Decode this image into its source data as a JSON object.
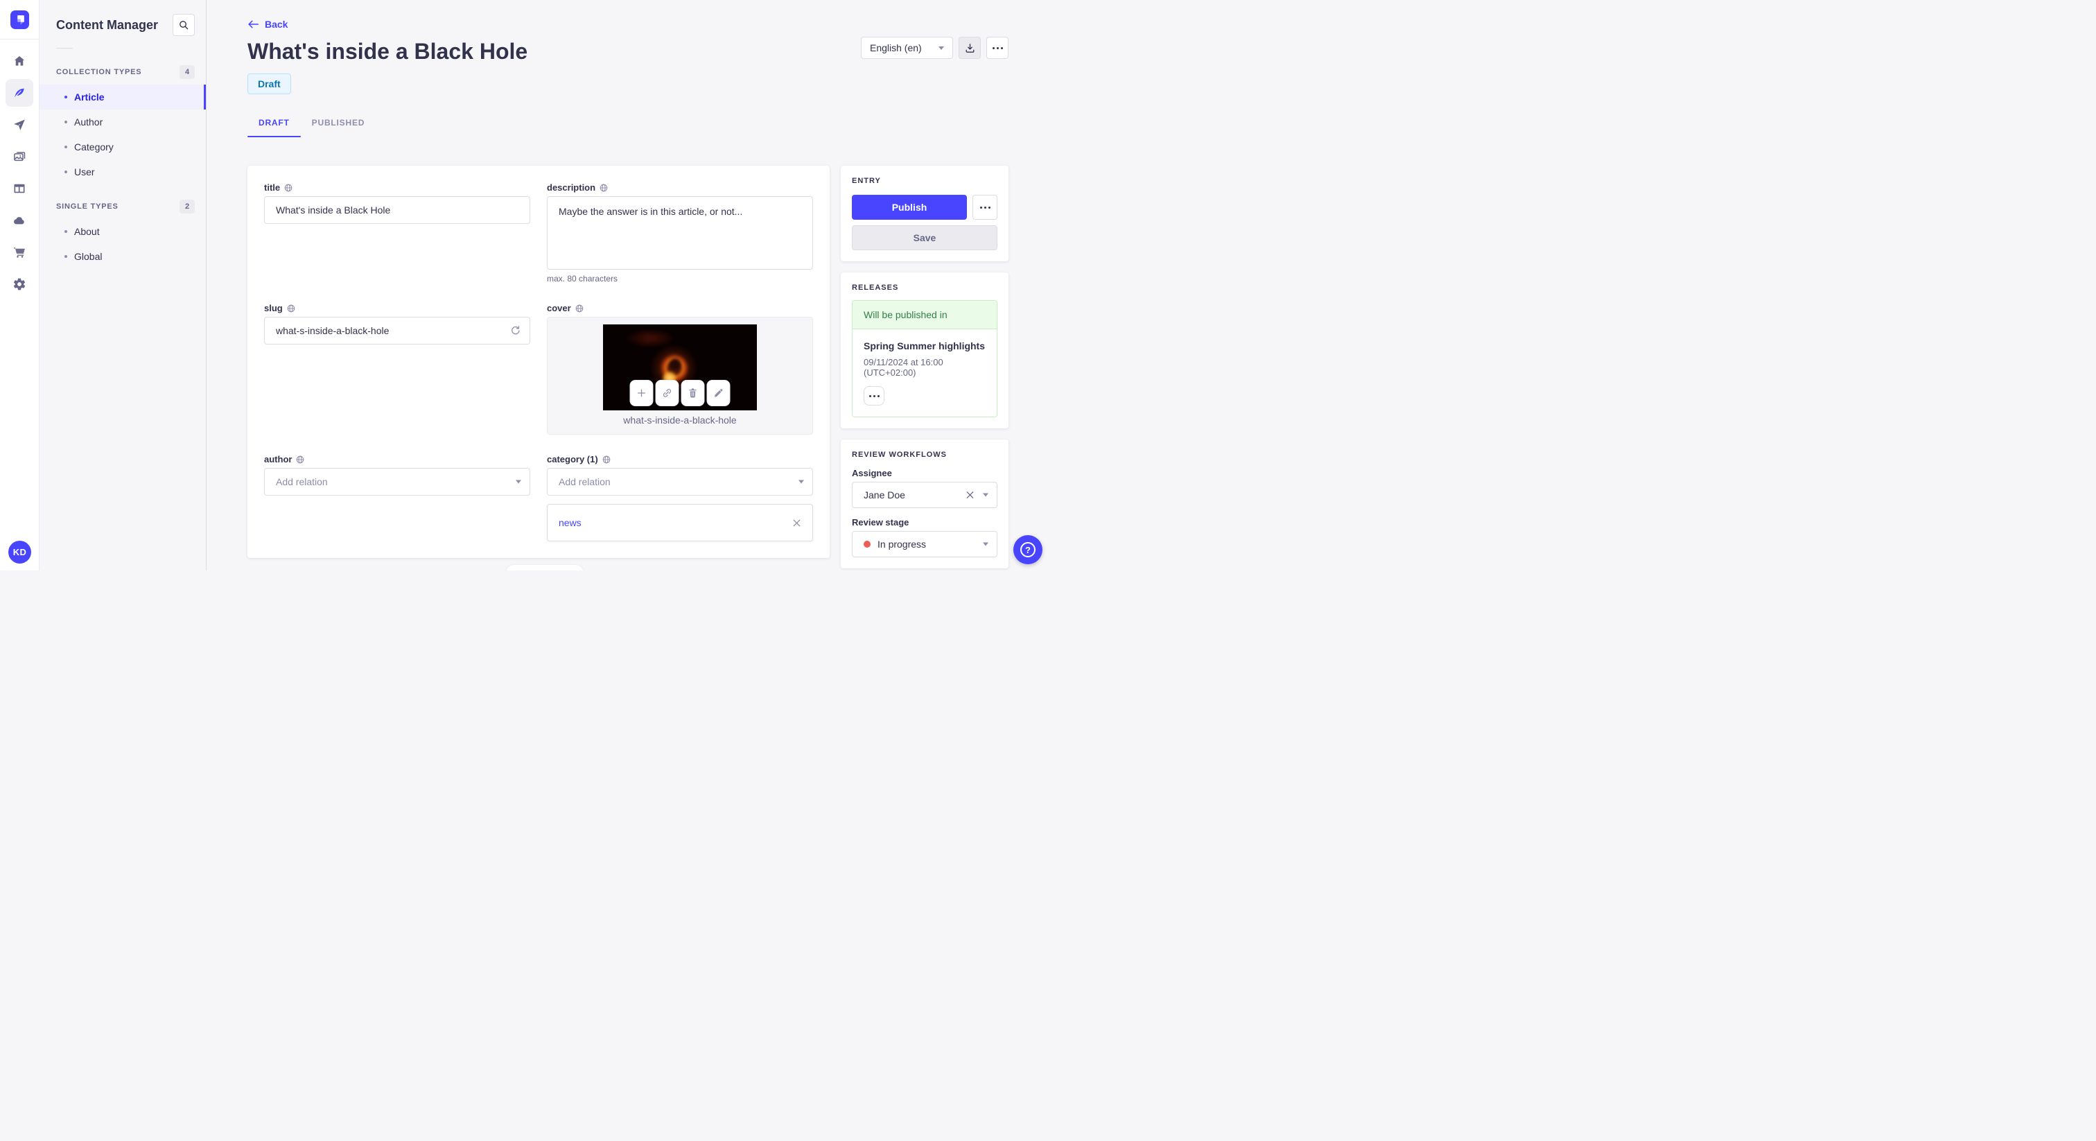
{
  "rail": {
    "avatar": "KD"
  },
  "sidebar": {
    "title": "Content Manager",
    "sections": [
      {
        "label": "COLLECTION TYPES",
        "count": "4",
        "items": [
          {
            "label": "Article",
            "active": true
          },
          {
            "label": "Author",
            "active": false
          },
          {
            "label": "Category",
            "active": false
          },
          {
            "label": "User",
            "active": false
          }
        ]
      },
      {
        "label": "SINGLE TYPES",
        "count": "2",
        "items": [
          {
            "label": "About",
            "active": false
          },
          {
            "label": "Global",
            "active": false
          }
        ]
      }
    ]
  },
  "header": {
    "back_label": "Back",
    "title": "What's inside a Black Hole",
    "status_badge": "Draft",
    "locale_selector": "English (en)"
  },
  "tabs": {
    "draft": "DRAFT",
    "published": "PUBLISHED"
  },
  "form": {
    "title": {
      "label": "title",
      "value": "What's inside a Black Hole"
    },
    "description": {
      "label": "description",
      "value": "Maybe the answer is in this article, or not...",
      "helper": "max. 80 characters"
    },
    "slug": {
      "label": "slug",
      "value": "what-s-inside-a-black-hole"
    },
    "cover": {
      "label": "cover",
      "caption": "what-s-inside-a-black-hole"
    },
    "author": {
      "label": "author",
      "placeholder": "Add relation"
    },
    "category": {
      "label": "category (1)",
      "placeholder": "Add relation",
      "relations": [
        "news"
      ]
    }
  },
  "entry_panel": {
    "title": "ENTRY",
    "publish_label": "Publish",
    "save_label": "Save"
  },
  "releases_panel": {
    "title": "RELEASES",
    "status": "Will be published in",
    "release_name": "Spring Summer highlights",
    "release_date": "09/11/2024 at 16:00 (UTC+02:00)"
  },
  "review_panel": {
    "title": "REVIEW WORKFLOWS",
    "assignee_label": "Assignee",
    "assignee_value": "Jane Doe",
    "stage_label": "Review stage",
    "stage_value": "In progress"
  },
  "help": {
    "question_mark": "?"
  },
  "colors": {
    "primary": "#4945ff",
    "active_link": "#271fe0",
    "draft_badge_text": "#0c75af",
    "success_text": "#328048",
    "stage_dot": "#ee5e52",
    "background": "#f6f6f9"
  }
}
